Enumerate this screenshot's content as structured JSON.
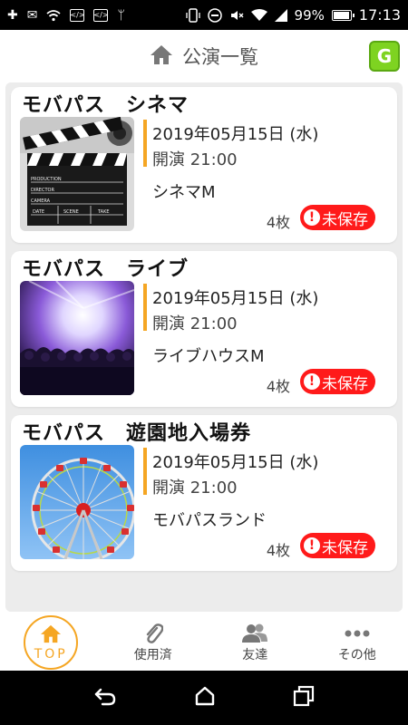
{
  "status_bar": {
    "battery": "99%",
    "time": "17:13"
  },
  "header": {
    "title": "公演一覧",
    "logo_text": "G"
  },
  "events": [
    {
      "title": "モバパス　シネマ",
      "date": "2019年05月15日 (水)",
      "start": "開演 21:00",
      "venue": "シネマM",
      "count": "4枚",
      "badge": "未保存",
      "thumb": "cinema-clapperboard"
    },
    {
      "title": "モバパス　ライブ",
      "date": "2019年05月15日 (水)",
      "start": "開演 21:00",
      "venue": "ライブハウスM",
      "count": "4枚",
      "badge": "未保存",
      "thumb": "concert-stage"
    },
    {
      "title": "モバパス　遊園地入場券",
      "date": "2019年05月15日 (水)",
      "start": "開演 21:00",
      "venue": "モバパスランド",
      "count": "4枚",
      "badge": "未保存",
      "thumb": "ferris-wheel"
    }
  ],
  "clapper_text": {
    "production": "PRODUCTION",
    "director": "DIRECTOR",
    "camera": "CAMERA",
    "date": "DATE",
    "scene": "SCENE",
    "take": "TAKE"
  },
  "bottom_nav": [
    {
      "label": "TOP",
      "icon": "home-icon",
      "active": true
    },
    {
      "label": "使用済",
      "icon": "paperclip-icon",
      "active": false
    },
    {
      "label": "友達",
      "icon": "people-icon",
      "active": false
    },
    {
      "label": "その他",
      "icon": "more-icon",
      "active": false
    }
  ],
  "colors": {
    "accent": "#f5a623",
    "badge": "#ff1a1a",
    "logo": "#7ed321"
  }
}
